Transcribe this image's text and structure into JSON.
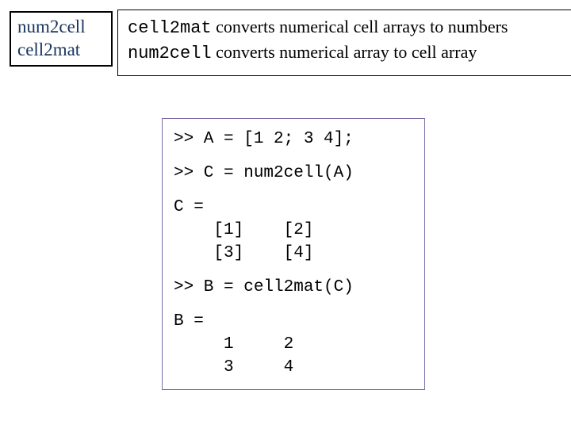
{
  "title": {
    "line1": "num2cell",
    "line2": "cell2mat"
  },
  "desc": {
    "fn1": "cell2mat",
    "rest1": " converts numerical cell arrays to numbers",
    "fn2": "num2cell",
    "rest2": " converts numerical array to cell array"
  },
  "code": {
    "l1": ">> A = [1 2; 3 4];",
    "l2": ">> C = num2cell(A)",
    "l3": "C =",
    "l4": "    [1]    [2]",
    "l5": "    [3]    [4]",
    "l6": ">> B = cell2mat(C)",
    "l7": "B =",
    "l8": "     1     2",
    "l9": "     3     4"
  }
}
